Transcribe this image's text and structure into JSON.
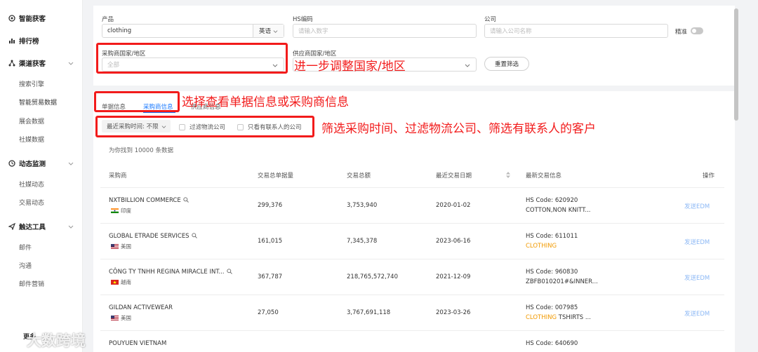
{
  "sidebar": {
    "sections": [
      {
        "label": "智能获客",
        "icon": "smart-acquire-icon"
      },
      {
        "label": "排行榜",
        "icon": "ranking-icon"
      },
      {
        "label": "渠道获客",
        "icon": "channel-icon"
      },
      {
        "label": "动态监测",
        "icon": "monitor-icon"
      },
      {
        "label": "触达工具",
        "icon": "send-icon"
      }
    ],
    "items": [
      "搜索引擎",
      "智能贸易数据",
      "展会数据",
      "社媒数据",
      "社媒动态",
      "交易动态",
      "邮件",
      "沟通",
      "邮件营销"
    ],
    "more": "更多"
  },
  "filters": {
    "product_label": "产品",
    "product_value": "clothing",
    "lang_label": "英语",
    "hs_label": "HS编码",
    "hs_placeholder": "请输入数字",
    "company_label": "公司",
    "company_placeholder": "请输入公司名称",
    "exact_label": "精准",
    "buyer_country_label": "采购商国家/地区",
    "buyer_country_value": "全部",
    "supplier_country_label": "供应商国家/地区",
    "reset_label": "重置筛选"
  },
  "tabs": [
    "单据信息",
    "采购商信息",
    "供应商信息"
  ],
  "sub_filters": {
    "time_label": "最近采购时间: 不限",
    "logistics_label": "过滤物流公司",
    "contacts_label": "只看有联系人的公司"
  },
  "result_count": "为你找到 10000 条数据",
  "table": {
    "headers": [
      "采购商",
      "交易总单据量",
      "交易总额",
      "最近交易日期",
      "最新交易信息",
      "操作"
    ],
    "rows": [
      {
        "company": "NXTBILLION COMMERCE",
        "country": "印度",
        "flag": "india",
        "orders": "299,376",
        "amount": "3,753,940",
        "date": "2020-01-02",
        "hs": "HS Code: 620920",
        "desc_pre": "COTTON,NON KNITT...",
        "desc_hl": "",
        "desc_post": "",
        "action": "发送EDM"
      },
      {
        "company": "GLOBAL ETRADE SERVICES",
        "country": "美国",
        "flag": "usa",
        "orders": "161,015",
        "amount": "7,345,378",
        "date": "2023-06-16",
        "hs": "HS Code: 611011",
        "desc_pre": "",
        "desc_hl": "CLOTHING",
        "desc_post": "",
        "action": "发送EDM"
      },
      {
        "company": "CÔNG TY TNHH REGINA MIRACLE INT...",
        "country": "越南",
        "flag": "vietnam",
        "orders": "367,787",
        "amount": "218,765,572,740",
        "date": "2021-12-09",
        "hs": "HS Code: 960830",
        "desc_pre": "ZBFB010201#&INNER...",
        "desc_hl": "",
        "desc_post": "",
        "action": "发送EDM"
      },
      {
        "company": "GILDAN ACTIVEWEAR",
        "country": "美国",
        "flag": "usa",
        "orders": "27,050",
        "amount": "3,767,691,118",
        "date": "2023-03-26",
        "hs": "HS Code: 007985",
        "desc_pre": "",
        "desc_hl": "CLOTHING",
        "desc_post": " TSHIRTS ...",
        "action": "发送EDM"
      },
      {
        "company": "POUYUEN VIETNAM",
        "country": "",
        "flag": "",
        "orders": "",
        "amount": "",
        "date": "",
        "hs": "HS Code: 640690",
        "desc_pre": "",
        "desc_hl": "",
        "desc_post": "",
        "action": ""
      }
    ]
  },
  "annotations": {
    "country": "进一步调整国家/地区",
    "tabs": "选择查看单据信息或采购商信息",
    "filters": "筛选采购时间、过滤物流公司、筛选有联系人的客户"
  },
  "watermark": "大数跨境",
  "colors": {
    "accent": "#1677ff",
    "annotation": "#f21b1b",
    "highlight": "#f29a00",
    "edm": "#8cb8f5"
  }
}
